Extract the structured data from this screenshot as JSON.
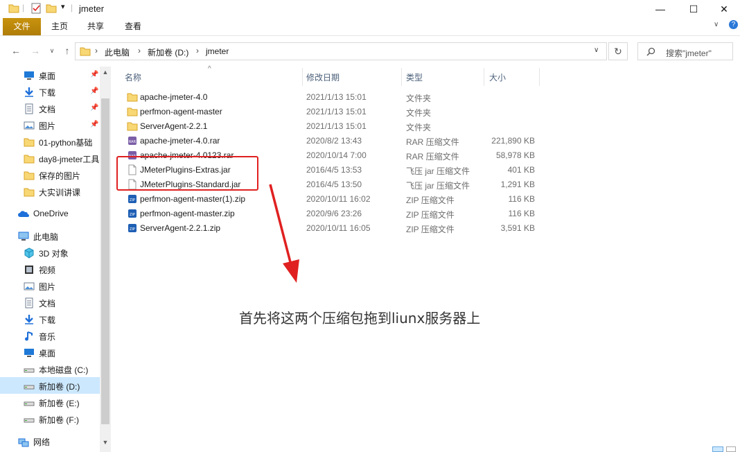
{
  "window": {
    "title": "jmeter",
    "controls": {
      "minimize": "—",
      "maximize": "☐",
      "close": "✕"
    }
  },
  "ribbon": {
    "tabs": [
      "文件",
      "主页",
      "共享",
      "查看"
    ]
  },
  "address": {
    "crumbs": [
      "此电脑",
      "新加卷 (D:)",
      "jmeter"
    ],
    "search_placeholder": "搜索\"jmeter\""
  },
  "nav": {
    "quick_access": [
      {
        "label": "桌面",
        "icon": "desktop-icon",
        "pinned": true
      },
      {
        "label": "下载",
        "icon": "download-icon",
        "pinned": true
      },
      {
        "label": "文档",
        "icon": "documents-icon",
        "pinned": true
      },
      {
        "label": "图片",
        "icon": "pictures-icon",
        "pinned": true
      },
      {
        "label": "01-python基础",
        "icon": "folder-icon",
        "pinned": false
      },
      {
        "label": "day8-jmeter工具",
        "icon": "folder-icon",
        "pinned": false
      },
      {
        "label": "保存的图片",
        "icon": "folder-icon",
        "pinned": false
      },
      {
        "label": "大实训讲课",
        "icon": "folder-icon",
        "pinned": false
      }
    ],
    "onedrive": "OneDrive",
    "this_pc": "此电脑",
    "pc_items": [
      {
        "label": "3D 对象",
        "icon": "3d-objects-icon"
      },
      {
        "label": "视频",
        "icon": "videos-icon"
      },
      {
        "label": "图片",
        "icon": "pictures-icon"
      },
      {
        "label": "文档",
        "icon": "documents-icon"
      },
      {
        "label": "下载",
        "icon": "download-icon"
      },
      {
        "label": "音乐",
        "icon": "music-icon"
      },
      {
        "label": "桌面",
        "icon": "desktop-icon"
      },
      {
        "label": "本地磁盘 (C:)",
        "icon": "drive-icon"
      },
      {
        "label": "新加卷 (D:)",
        "icon": "drive-icon",
        "selected": true
      },
      {
        "label": "新加卷 (E:)",
        "icon": "drive-icon"
      },
      {
        "label": "新加卷 (F:)",
        "icon": "drive-icon"
      }
    ],
    "network": "网络"
  },
  "columns": {
    "name": "名称",
    "date": "修改日期",
    "type": "类型",
    "size": "大小"
  },
  "files": [
    {
      "name": "apache-jmeter-4.0",
      "date": "2021/1/13 15:01",
      "type": "文件夹",
      "size": "",
      "icon": "folder-icon"
    },
    {
      "name": "perfmon-agent-master",
      "date": "2021/1/13 15:01",
      "type": "文件夹",
      "size": "",
      "icon": "folder-icon"
    },
    {
      "name": "ServerAgent-2.2.1",
      "date": "2021/1/13 15:01",
      "type": "文件夹",
      "size": "",
      "icon": "folder-icon"
    },
    {
      "name": "apache-jmeter-4.0.rar",
      "date": "2020/8/2 13:43",
      "type": "RAR 压缩文件",
      "size": "221,890 KB",
      "icon": "rar-icon"
    },
    {
      "name": "apache-jmeter-4.0123.rar",
      "date": "2020/10/14 7:00",
      "type": "RAR 压缩文件",
      "size": "58,978 KB",
      "icon": "rar-icon"
    },
    {
      "name": "JMeterPlugins-Extras.jar",
      "date": "2016/4/5 13:53",
      "type": "飞压 jar 压缩文件",
      "size": "401 KB",
      "icon": "jar-file-icon"
    },
    {
      "name": "JMeterPlugins-Standard.jar",
      "date": "2016/4/5 13:50",
      "type": "飞压 jar 压缩文件",
      "size": "1,291 KB",
      "icon": "jar-file-icon"
    },
    {
      "name": "perfmon-agent-master(1).zip",
      "date": "2020/10/11 16:02",
      "type": "ZIP 压缩文件",
      "size": "116 KB",
      "icon": "zip-icon"
    },
    {
      "name": "perfmon-agent-master.zip",
      "date": "2020/9/6 23:26",
      "type": "ZIP 压缩文件",
      "size": "116 KB",
      "icon": "zip-icon"
    },
    {
      "name": "ServerAgent-2.2.1.zip",
      "date": "2020/10/11 16:05",
      "type": "ZIP 压缩文件",
      "size": "3,591 KB",
      "icon": "zip-icon"
    }
  ],
  "annotation": "首先将这两个压缩包拖到liunx服务器上",
  "colors": {
    "file_tab": "#b8860b",
    "selection": "#cce8ff",
    "highlight_box": "#e02020",
    "arrow": "#e02020"
  }
}
